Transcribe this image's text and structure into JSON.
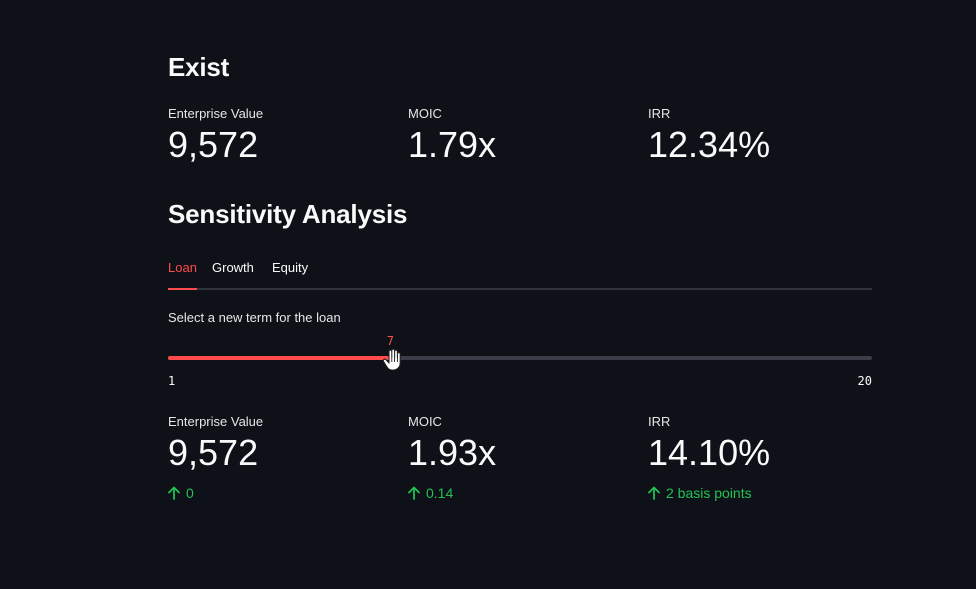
{
  "exist": {
    "heading": "Exist",
    "metrics": [
      {
        "label": "Enterprise Value",
        "value": "9,572"
      },
      {
        "label": "MOIC",
        "value": "1.79x"
      },
      {
        "label": "IRR",
        "value": "12.34%"
      }
    ]
  },
  "sensitivity": {
    "heading": "Sensitivity Analysis",
    "tabs": [
      {
        "label": "Loan",
        "active": true
      },
      {
        "label": "Growth",
        "active": false
      },
      {
        "label": "Equity",
        "active": false
      }
    ],
    "slider": {
      "label": "Select a new term for the loan",
      "min": 1,
      "max": 20,
      "value": 7,
      "min_label": "1",
      "max_label": "20",
      "value_label": "7"
    },
    "metrics": [
      {
        "label": "Enterprise Value",
        "value": "9,572",
        "delta": "0"
      },
      {
        "label": "MOIC",
        "value": "1.93x",
        "delta": "0.14"
      },
      {
        "label": "IRR",
        "value": "14.10%",
        "delta": "2 basis points"
      }
    ]
  },
  "colors": {
    "background": "#0e1117",
    "accent": "#ff4b4b",
    "positive": "#21c354",
    "track": "#3a3c47"
  },
  "icons": {
    "delta": "arrow-up-icon",
    "cursor": "hand-cursor-icon"
  }
}
